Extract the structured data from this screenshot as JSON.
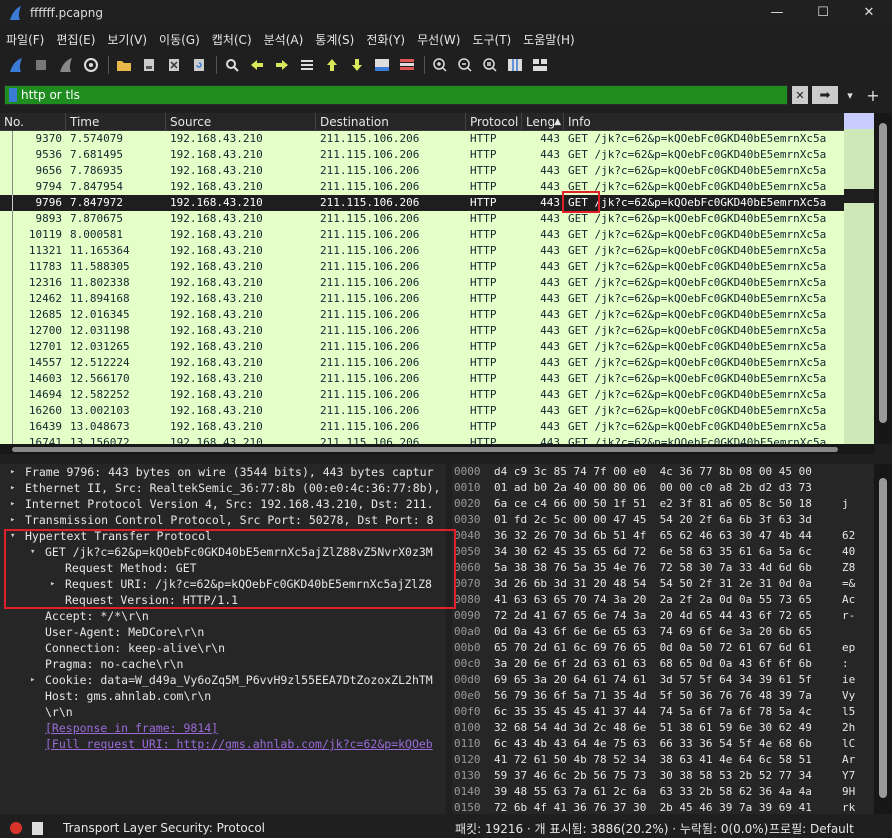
{
  "window": {
    "title": "ffffff.pcapng",
    "minimize": "—",
    "maximize": "☐",
    "close": "✕"
  },
  "menu": [
    "파일(F)",
    "편집(E)",
    "보기(V)",
    "이동(G)",
    "캡처(C)",
    "분석(A)",
    "통계(S)",
    "전화(Y)",
    "무선(W)",
    "도구(T)",
    "도움말(H)"
  ],
  "toolbar_icons": [
    "shark-fin-start-icon",
    "stop-icon",
    "restart-fin-icon",
    "options-gear-icon",
    "open-folder-icon",
    "save-file-icon",
    "close-file-icon",
    "reload-icon",
    "find-magnifier-icon",
    "back-arrow-icon",
    "forward-arrow-icon",
    "go-to-packet-icon",
    "first-packet-icon",
    "last-packet-icon",
    "autoscroll-icon",
    "colorize-icon",
    "zoom-in-icon",
    "zoom-out-icon",
    "zoom-normal-icon",
    "resize-columns-icon",
    "layout-icon"
  ],
  "filter": {
    "value": "http or tls",
    "clear": "✕",
    "apply": "➡",
    "dropdown": "▾",
    "add": "+"
  },
  "columns": [
    "No.",
    "Time",
    "Source",
    "Destination",
    "Protocol",
    "Leng",
    "Info"
  ],
  "packets": [
    {
      "no": "9370",
      "time": "7.574079",
      "src": "192.168.43.210",
      "dst": "211.115.106.206",
      "proto": "HTTP",
      "len": "443",
      "info": "GET /jk?c=62&p=kQOebFc0GKD40bE5emrnXc5a"
    },
    {
      "no": "9536",
      "time": "7.681495",
      "src": "192.168.43.210",
      "dst": "211.115.106.206",
      "proto": "HTTP",
      "len": "443",
      "info": "GET /jk?c=62&p=kQOebFc0GKD40bE5emrnXc5a"
    },
    {
      "no": "9656",
      "time": "7.786935",
      "src": "192.168.43.210",
      "dst": "211.115.106.206",
      "proto": "HTTP",
      "len": "443",
      "info": "GET /jk?c=62&p=kQOebFc0GKD40bE5emrnXc5a"
    },
    {
      "no": "9794",
      "time": "7.847954",
      "src": "192.168.43.210",
      "dst": "211.115.106.206",
      "proto": "HTTP",
      "len": "443",
      "info": "GET /jk?c=62&p=kQOebFc0GKD40bE5emrnXc5a"
    },
    {
      "no": "9796",
      "time": "7.847972",
      "src": "192.168.43.210",
      "dst": "211.115.106.206",
      "proto": "HTTP",
      "len": "443",
      "info": "GET /jk?c=62&p=kQOebFc0GKD40bE5emrnXc5a",
      "selected": true
    },
    {
      "no": "9893",
      "time": "7.870675",
      "src": "192.168.43.210",
      "dst": "211.115.106.206",
      "proto": "HTTP",
      "len": "443",
      "info": "GET /jk?c=62&p=kQOebFc0GKD40bE5emrnXc5a"
    },
    {
      "no": "10119",
      "time": "8.000581",
      "src": "192.168.43.210",
      "dst": "211.115.106.206",
      "proto": "HTTP",
      "len": "443",
      "info": "GET /jk?c=62&p=kQOebFc0GKD40bE5emrnXc5a"
    },
    {
      "no": "11321",
      "time": "11.165364",
      "src": "192.168.43.210",
      "dst": "211.115.106.206",
      "proto": "HTTP",
      "len": "443",
      "info": "GET /jk?c=62&p=kQOebFc0GKD40bE5emrnXc5a"
    },
    {
      "no": "11783",
      "time": "11.588305",
      "src": "192.168.43.210",
      "dst": "211.115.106.206",
      "proto": "HTTP",
      "len": "443",
      "info": "GET /jk?c=62&p=kQOebFc0GKD40bE5emrnXc5a"
    },
    {
      "no": "12316",
      "time": "11.802338",
      "src": "192.168.43.210",
      "dst": "211.115.106.206",
      "proto": "HTTP",
      "len": "443",
      "info": "GET /jk?c=62&p=kQOebFc0GKD40bE5emrnXc5a"
    },
    {
      "no": "12462",
      "time": "11.894168",
      "src": "192.168.43.210",
      "dst": "211.115.106.206",
      "proto": "HTTP",
      "len": "443",
      "info": "GET /jk?c=62&p=kQOebFc0GKD40bE5emrnXc5a"
    },
    {
      "no": "12685",
      "time": "12.016345",
      "src": "192.168.43.210",
      "dst": "211.115.106.206",
      "proto": "HTTP",
      "len": "443",
      "info": "GET /jk?c=62&p=kQOebFc0GKD40bE5emrnXc5a"
    },
    {
      "no": "12700",
      "time": "12.031198",
      "src": "192.168.43.210",
      "dst": "211.115.106.206",
      "proto": "HTTP",
      "len": "443",
      "info": "GET /jk?c=62&p=kQOebFc0GKD40bE5emrnXc5a"
    },
    {
      "no": "12701",
      "time": "12.031265",
      "src": "192.168.43.210",
      "dst": "211.115.106.206",
      "proto": "HTTP",
      "len": "443",
      "info": "GET /jk?c=62&p=kQOebFc0GKD40bE5emrnXc5a"
    },
    {
      "no": "14557",
      "time": "12.512224",
      "src": "192.168.43.210",
      "dst": "211.115.106.206",
      "proto": "HTTP",
      "len": "443",
      "info": "GET /jk?c=62&p=kQOebFc0GKD40bE5emrnXc5a"
    },
    {
      "no": "14603",
      "time": "12.566170",
      "src": "192.168.43.210",
      "dst": "211.115.106.206",
      "proto": "HTTP",
      "len": "443",
      "info": "GET /jk?c=62&p=kQOebFc0GKD40bE5emrnXc5a"
    },
    {
      "no": "14694",
      "time": "12.582252",
      "src": "192.168.43.210",
      "dst": "211.115.106.206",
      "proto": "HTTP",
      "len": "443",
      "info": "GET /jk?c=62&p=kQOebFc0GKD40bE5emrnXc5a"
    },
    {
      "no": "16260",
      "time": "13.002103",
      "src": "192.168.43.210",
      "dst": "211.115.106.206",
      "proto": "HTTP",
      "len": "443",
      "info": "GET /jk?c=62&p=kQOebFc0GKD40bE5emrnXc5a"
    },
    {
      "no": "16439",
      "time": "13.048673",
      "src": "192.168.43.210",
      "dst": "211.115.106.206",
      "proto": "HTTP",
      "len": "443",
      "info": "GET /jk?c=62&p=kQOebFc0GKD40bE5emrnXc5a"
    },
    {
      "no": "16741",
      "time": "13.156072",
      "src": "192.168.43.210",
      "dst": "211.115.106.206",
      "proto": "HTTP",
      "len": "443",
      "info": "GET /jk?c=62&p=kQOebFc0GKD40bE5emrnXc5a"
    }
  ],
  "details": [
    {
      "indent": 0,
      "arrow": "▸",
      "text": "Frame 9796: 443 bytes on wire (3544 bits), 443 bytes captur"
    },
    {
      "indent": 0,
      "arrow": "▸",
      "text": "Ethernet II, Src: RealtekSemic_36:77:8b (00:e0:4c:36:77:8b), Dst"
    },
    {
      "indent": 0,
      "arrow": "▸",
      "text": "Internet Protocol Version 4, Src: 192.168.43.210, Dst: 211."
    },
    {
      "indent": 0,
      "arrow": "▸",
      "text": "Transmission Control Protocol, Src Port: 50278, Dst Port: 8"
    },
    {
      "indent": 0,
      "arrow": "▾",
      "text": "Hypertext Transfer Protocol"
    },
    {
      "indent": 1,
      "arrow": "▾",
      "text": "GET /jk?c=62&p=kQOebFc0GKD40bE5emrnXc5ajZlZ88vZ5NvrX0z3M"
    },
    {
      "indent": 2,
      "arrow": "",
      "text": "Request Method: GET"
    },
    {
      "indent": 2,
      "arrow": "▸",
      "text": "Request URI: /jk?c=62&p=kQOebFc0GKD40bE5emrnXc5ajZlZ8"
    },
    {
      "indent": 2,
      "arrow": "",
      "text": "Request Version: HTTP/1.1"
    },
    {
      "indent": 1,
      "arrow": "",
      "text": "Accept: */*\\r\\n"
    },
    {
      "indent": 1,
      "arrow": "",
      "text": "User-Agent: MeDCore\\r\\n"
    },
    {
      "indent": 1,
      "arrow": "",
      "text": "Connection: keep-alive\\r\\n"
    },
    {
      "indent": 1,
      "arrow": "",
      "text": "Pragma: no-cache\\r\\n"
    },
    {
      "indent": 1,
      "arrow": "▸",
      "text": "Cookie: data=W_d49a_Vy6oZq5M_P6vvH9zl55EEA7DtZozoxZL2hTM"
    },
    {
      "indent": 1,
      "arrow": "",
      "text": "Host: gms.ahnlab.com\\r\\n"
    },
    {
      "indent": 1,
      "arrow": "",
      "text": "\\r\\n"
    },
    {
      "indent": 1,
      "arrow": "",
      "text": "[Response in frame: 9814]",
      "link": true
    },
    {
      "indent": 1,
      "arrow": "",
      "text": "[Full request URI: http://gms.ahnlab.com/jk?c=62&p=kQOeb",
      "link": true
    }
  ],
  "bytes": [
    {
      "off": "0000",
      "hex": "d4 c9 3c 85 74 7f 00 e0  4c 36 77 8b 08 00 45 00",
      "asc": ""
    },
    {
      "off": "0010",
      "hex": "01 ad b0 2a 40 00 80 06  00 00 c0 a8 2b d2 d3 73",
      "asc": ""
    },
    {
      "off": "0020",
      "hex": "6a ce c4 66 00 50 1f 51  e2 3f 81 a6 05 8c 50 18",
      "asc": "j"
    },
    {
      "off": "0030",
      "hex": "01 fd 2c 5c 00 00 47 45  54 20 2f 6a 6b 3f 63 3d",
      "asc": ""
    },
    {
      "off": "0040",
      "hex": "36 32 26 70 3d 6b 51 4f  65 62 46 63 30 47 4b 44",
      "asc": "62"
    },
    {
      "off": "0050",
      "hex": "34 30 62 45 35 65 6d 72  6e 58 63 35 61 6a 5a 6c",
      "asc": "40"
    },
    {
      "off": "0060",
      "hex": "5a 38 38 76 5a 35 4e 76  72 58 30 7a 33 4d 6d 6b",
      "asc": "Z8"
    },
    {
      "off": "0070",
      "hex": "3d 26 6b 3d 31 20 48 54  54 50 2f 31 2e 31 0d 0a",
      "asc": "=&"
    },
    {
      "off": "0080",
      "hex": "41 63 63 65 70 74 3a 20  2a 2f 2a 0d 0a 55 73 65",
      "asc": "Ac"
    },
    {
      "off": "0090",
      "hex": "72 2d 41 67 65 6e 74 3a  20 4d 65 44 43 6f 72 65",
      "asc": "r-"
    },
    {
      "off": "00a0",
      "hex": "0d 0a 43 6f 6e 6e 65 63  74 69 6f 6e 3a 20 6b 65",
      "asc": ""
    },
    {
      "off": "00b0",
      "hex": "65 70 2d 61 6c 69 76 65  0d 0a 50 72 61 67 6d 61",
      "asc": "ep"
    },
    {
      "off": "00c0",
      "hex": "3a 20 6e 6f 2d 63 61 63  68 65 0d 0a 43 6f 6f 6b",
      "asc": ":"
    },
    {
      "off": "00d0",
      "hex": "69 65 3a 20 64 61 74 61  3d 57 5f 64 34 39 61 5f",
      "asc": "ie"
    },
    {
      "off": "00e0",
      "hex": "56 79 36 6f 5a 71 35 4d  5f 50 36 76 76 48 39 7a",
      "asc": "Vy"
    },
    {
      "off": "00f0",
      "hex": "6c 35 35 45 45 41 37 44  74 5a 6f 7a 6f 78 5a 4c",
      "asc": "l5"
    },
    {
      "off": "0100",
      "hex": "32 68 54 4d 3d 2c 48 6e  51 38 61 59 6e 30 62 49",
      "asc": "2h"
    },
    {
      "off": "0110",
      "hex": "6c 43 4b 43 64 4e 75 63  66 33 36 54 5f 4e 68 6b",
      "asc": "lC"
    },
    {
      "off": "0120",
      "hex": "41 72 61 50 4b 78 52 34  38 63 41 4e 64 6c 58 51",
      "asc": "Ar"
    },
    {
      "off": "0130",
      "hex": "59 37 46 6c 2b 56 75 73  30 38 58 53 2b 52 77 34",
      "asc": "Y7"
    },
    {
      "off": "0140",
      "hex": "39 48 55 63 7a 61 2c 6a  63 33 2b 58 62 36 4a 4a",
      "asc": "9H"
    },
    {
      "off": "0150",
      "hex": "72 6b 4f 41 36 76 37 30  2b 45 46 39 7a 39 69 41",
      "asc": "rk"
    },
    {
      "off": "0160",
      "hex": "6c 70 79 41 4e 47 56 46  4c 55 48 66 5a 4a 4e 50",
      "asc": "lp"
    }
  ],
  "status": {
    "left": "Transport Layer Security: Protocol",
    "packets": "패킷: 19216 · 개 표시됨: 3886(20.2%) · 누락됨: 0(0.0%)",
    "profile": "프로필: Default"
  },
  "colors": {
    "accent": "#3a7bd5",
    "filter_ok": "#1e8c1e",
    "row_bg": "#e4ffc7",
    "highlight": "#e0202a"
  }
}
